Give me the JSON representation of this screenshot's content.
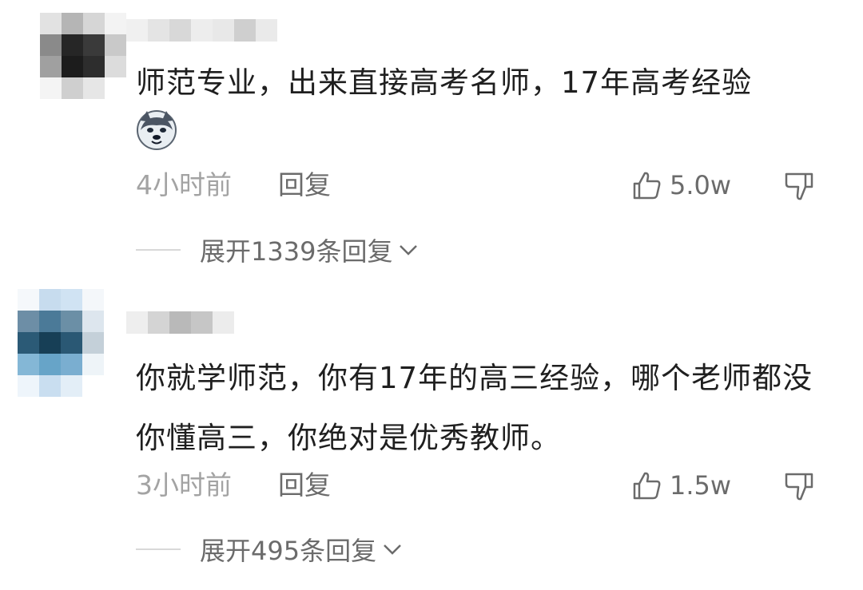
{
  "comments": [
    {
      "text": "师范专业，出来直接高考名师，17年高考经验",
      "emoji": "dog-sticker-icon",
      "time": "4小时前",
      "reply_label": "回复",
      "likes": "5.0w",
      "expand_label": "展开1339条回复"
    },
    {
      "text": "你就学师范，你有17年的高三经验，哪个老师都没你懂高三，你绝对是优秀教师。",
      "time": "3小时前",
      "reply_label": "回复",
      "likes": "1.5w",
      "expand_label": "展开495条回复"
    }
  ],
  "colors": {
    "meta_gray": "#a3a3a3",
    "action_gray": "#6b6b6b",
    "text": "#1f1f1f"
  }
}
